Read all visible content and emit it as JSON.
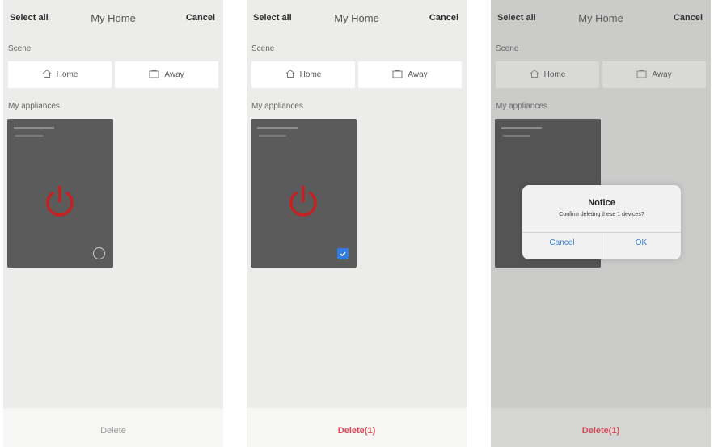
{
  "screens": [
    {
      "header": {
        "select_all": "Select all",
        "title": "My Home",
        "cancel": "Cancel"
      },
      "scene_label": "Scene",
      "scenes": [
        {
          "label": "Home",
          "icon": "home-icon"
        },
        {
          "label": "Away",
          "icon": "away-icon"
        }
      ],
      "appliances_label": "My appliances",
      "card": {
        "selected": false,
        "icon": "power-icon"
      },
      "delete_label": "Delete"
    },
    {
      "header": {
        "select_all": "Select all",
        "title": "My Home",
        "cancel": "Cancel"
      },
      "scene_label": "Scene",
      "scenes": [
        {
          "label": "Home",
          "icon": "home-icon"
        },
        {
          "label": "Away",
          "icon": "away-icon"
        }
      ],
      "appliances_label": "My appliances",
      "card": {
        "selected": true,
        "icon": "power-icon"
      },
      "delete_label": "Delete(1)"
    },
    {
      "header": {
        "select_all": "Select all",
        "title": "My Home",
        "cancel": "Cancel"
      },
      "scene_label": "Scene",
      "scenes": [
        {
          "label": "Home",
          "icon": "home-icon"
        },
        {
          "label": "Away",
          "icon": "away-icon"
        }
      ],
      "appliances_label": "My appliances",
      "card": {
        "selected": true,
        "icon": "power-icon"
      },
      "delete_label": "Delete(1)",
      "dialog": {
        "title": "Notice",
        "message": "Confirm deleting these 1 devices?",
        "cancel": "Cancel",
        "ok": "OK"
      }
    }
  ],
  "colors": {
    "accent_red": "#e04455",
    "accent_blue": "#2f7de1",
    "power_red": "#c82020"
  }
}
